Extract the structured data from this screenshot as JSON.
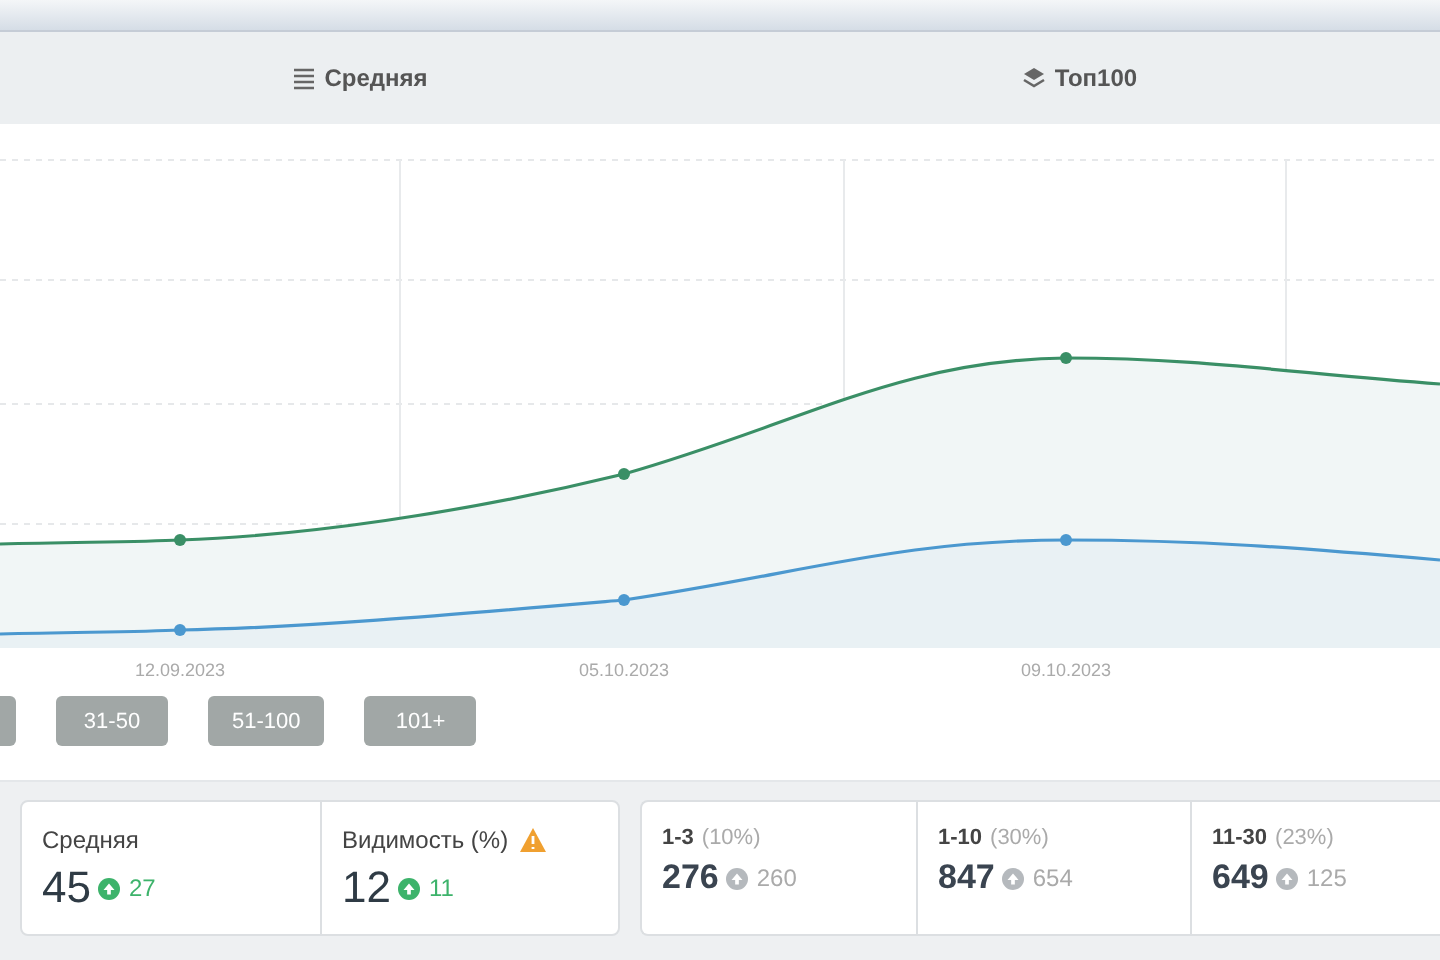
{
  "tabs": [
    {
      "label": "Средняя",
      "kind": "average"
    },
    {
      "label": "Топ100",
      "kind": "top"
    }
  ],
  "chart": {
    "dates": [
      "12.09.2023",
      "05.10.2023",
      "09.10.2023"
    ]
  },
  "filters": [
    {
      "kind": "partial"
    },
    {
      "label": "31-50"
    },
    {
      "label": "51-100"
    },
    {
      "label": "101+"
    }
  ],
  "summary": [
    {
      "title": "Средняя",
      "value": "45",
      "delta": "27",
      "warning": false
    },
    {
      "title": "Видимость (%)",
      "value": "12",
      "delta": "11",
      "warning": true
    }
  ],
  "ranges": [
    {
      "range": "1-3",
      "share": "(10%)",
      "value": "276",
      "delta": "260"
    },
    {
      "range": "1-10",
      "share": "(30%)",
      "value": "847",
      "delta": "654"
    },
    {
      "range": "11-30",
      "share": "(23%)",
      "value": "649",
      "delta": "125"
    }
  ]
}
